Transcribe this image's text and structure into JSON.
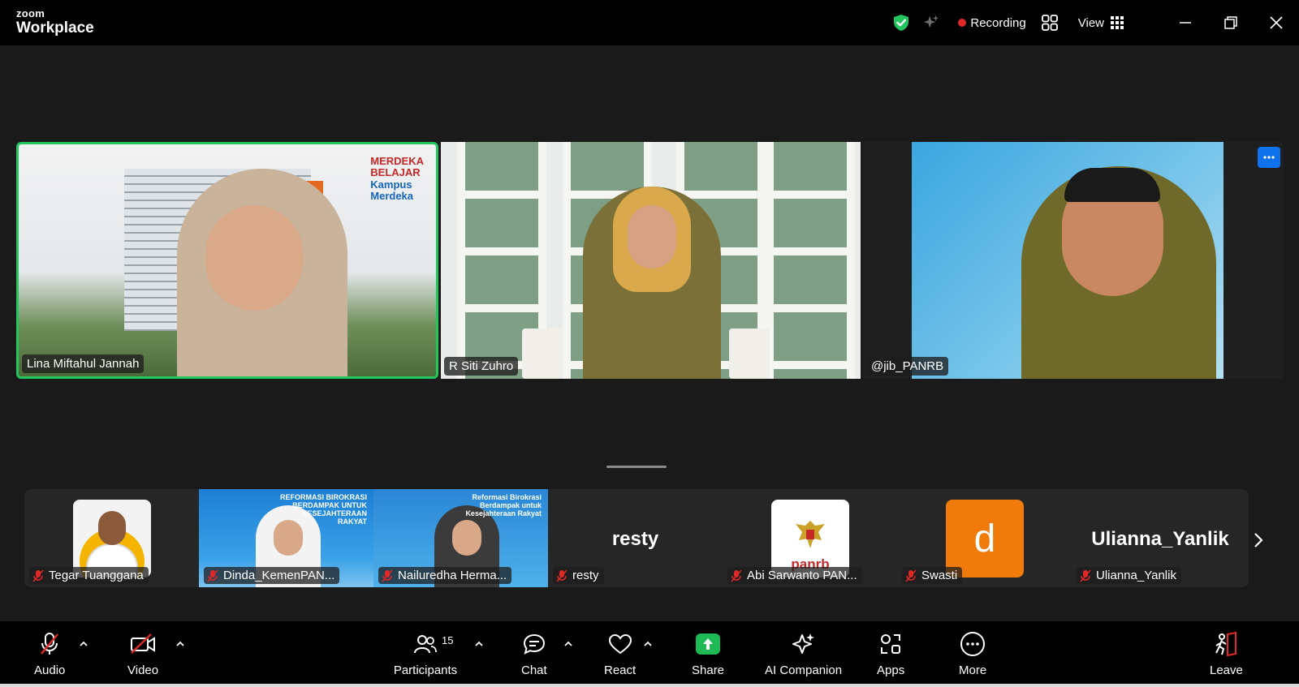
{
  "app": {
    "brand_top": "zoom",
    "brand_bottom": "Workplace"
  },
  "header": {
    "recording_label": "Recording",
    "view_label": "View"
  },
  "colors": {
    "accent_green": "#22c55e",
    "recording_red": "#e02828",
    "share_green": "#1db954",
    "avatar_orange": "#f07b0b",
    "button_blue": "#0e72ed"
  },
  "main_tiles": [
    {
      "name": "Lina Miftahul Jannah",
      "active_speaker": true
    },
    {
      "name": "R Siti Zuhro"
    },
    {
      "name": "@jib_PANRB"
    }
  ],
  "tile_banner": {
    "line1": "MERDEKA",
    "line2": "BELAJAR",
    "line3": "Kampus",
    "line4": "Merdeka"
  },
  "filmstrip": [
    {
      "name": "Tegar Tuanggana",
      "muted": true,
      "avatar": "photo"
    },
    {
      "name": "Dinda_KemenPAN...",
      "muted": true,
      "avatar": "video",
      "banner": "REFORMASI BIROKRASI BERDAMPAK UNTUK KESEJAHTERAAN RAKYAT"
    },
    {
      "name": "Nailuredha Herma...",
      "muted": true,
      "avatar": "video",
      "banner": "Reformasi Birokrasi Berdampak untuk Kesejahteraan Rakyat"
    },
    {
      "name": "resty",
      "muted": true,
      "avatar": "name",
      "display": "resty"
    },
    {
      "name": "Abi Sarwanto PAN...",
      "muted": true,
      "avatar": "logo",
      "logo_text": "panrb"
    },
    {
      "name": "Swasti",
      "muted": true,
      "avatar": "letter",
      "letter": "d"
    },
    {
      "name": "Ulianna_Yanlik",
      "muted": true,
      "avatar": "name",
      "display": "Ulianna_Yanlik"
    }
  ],
  "toolbar": {
    "audio": "Audio",
    "video": "Video",
    "participants": "Participants",
    "participants_count": "15",
    "chat": "Chat",
    "react": "React",
    "share": "Share",
    "ai_companion": "AI Companion",
    "apps": "Apps",
    "more": "More",
    "leave": "Leave"
  }
}
